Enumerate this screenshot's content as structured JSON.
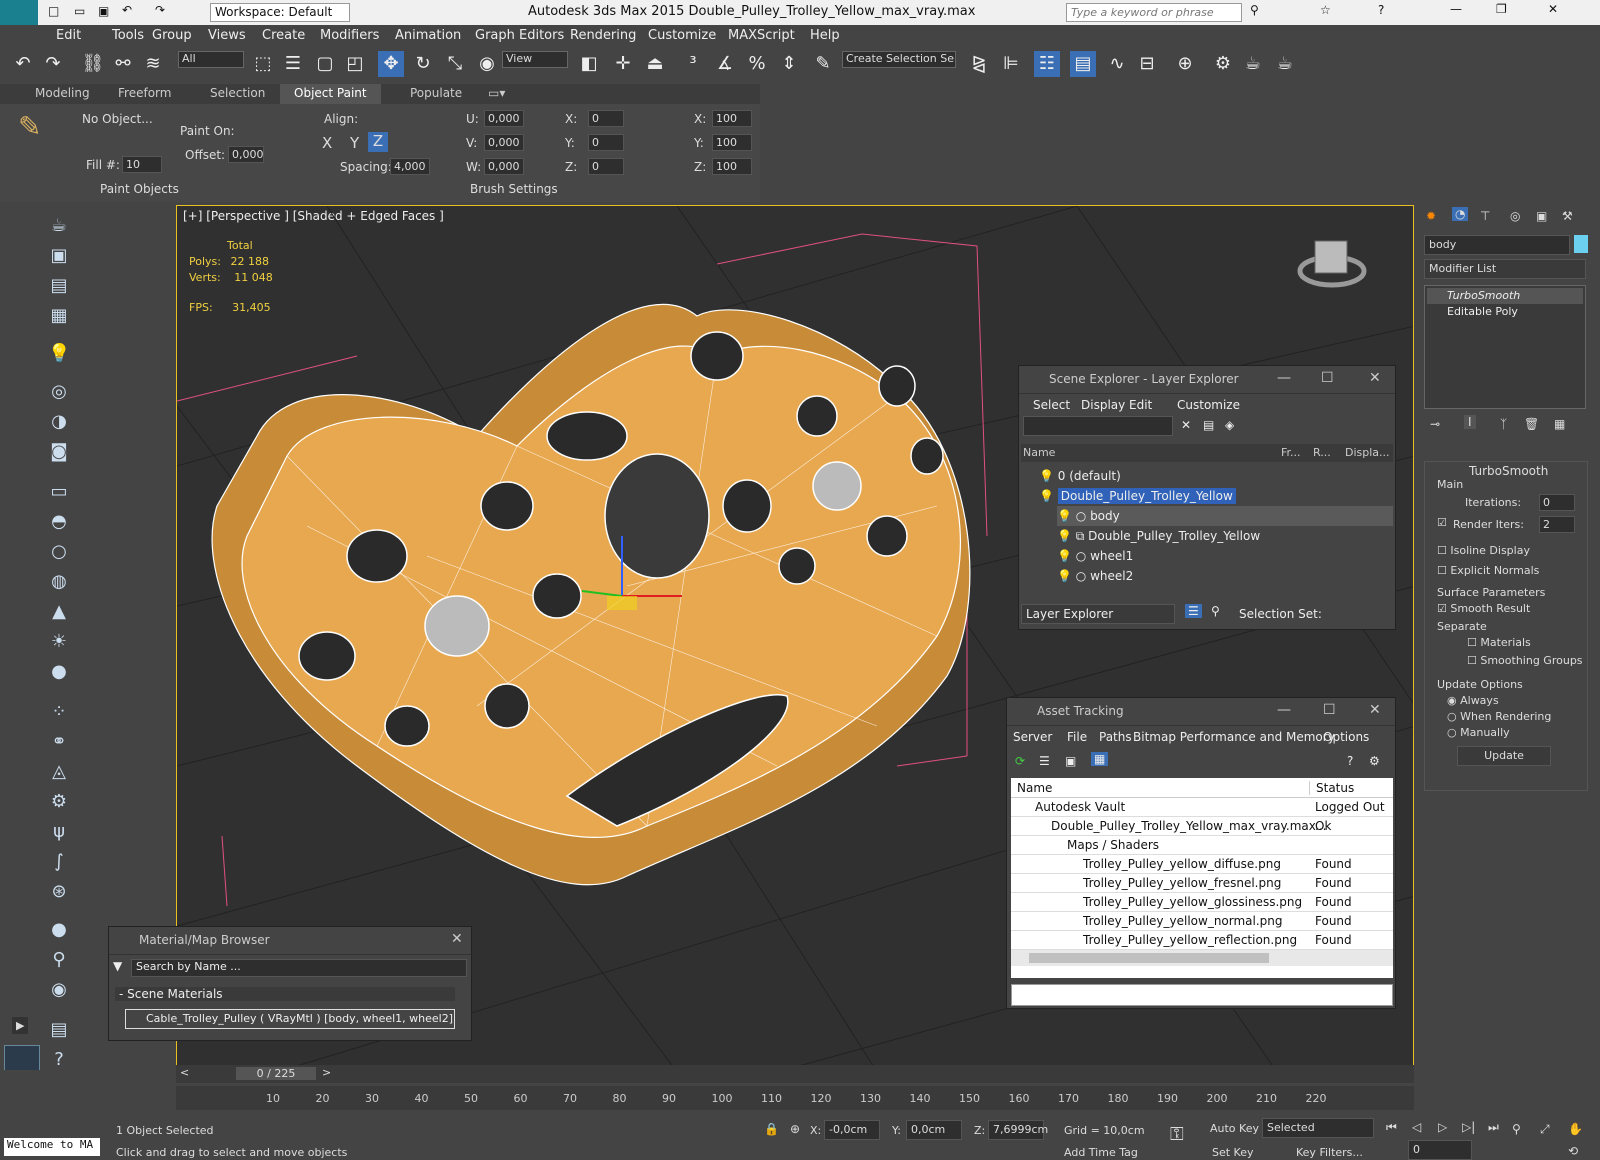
{
  "title": {
    "workspace": "Workspace: Default",
    "app_title": "Autodesk 3ds Max  2015     Double_Pulley_Trolley_Yellow_max_vray.max",
    "search_placeholder": "Type a keyword or phrase",
    "logo": "MAX"
  },
  "menu": [
    "Edit",
    "Tools",
    "Group",
    "Views",
    "Create",
    "Modifiers",
    "Animation",
    "Graph Editors",
    "Rendering",
    "Customize",
    "MAXScript",
    "Help"
  ],
  "toolbar": {
    "selection_filter": "All",
    "view_dropdown": "View",
    "selection_set": "Create Selection Se"
  },
  "ribbon": {
    "tabs": [
      "Modeling",
      "Freeform",
      "Selection",
      "Object Paint",
      "Populate"
    ],
    "active_tab": "Object Paint",
    "no_object": "No Object...",
    "paint_on": "Paint On:",
    "offset": "Offset:",
    "offset_val": "0,000",
    "fill": "Fill #:",
    "fill_val": "10",
    "align": "Align:",
    "x": "X",
    "y": "Y",
    "z": "Z",
    "spacing": "Spacing:",
    "spacing_val": "4,000",
    "u": "U:",
    "v": "V:",
    "w": "W:",
    "uval": "0,000",
    "vval": "0,000",
    "wval": "0,000",
    "rx": "X:",
    "ry": "Y:",
    "rz": "Z:",
    "rxv": "0",
    "ryv": "0",
    "rzv": "0",
    "sx": "X:",
    "sy": "Y:",
    "sz": "Z:",
    "sxv": "100",
    "syv": "100",
    "szv": "100",
    "paint_objects": "Paint Objects",
    "brush_settings": "Brush Settings"
  },
  "viewport": {
    "label": "[+] [Perspective ] [Shaded + Edged Faces ]",
    "total": "Total",
    "polys_label": "Polys:",
    "polys": "22 188",
    "verts_label": "Verts:",
    "verts": "11 048",
    "fps_label": "FPS:",
    "fps": "31,405"
  },
  "scene_explorer": {
    "title": "Scene Explorer - Layer Explorer",
    "menu": [
      "Select",
      "Display",
      "Edit",
      "Customize"
    ],
    "cols": [
      "Name",
      "Fr...",
      "R...",
      "Displa..."
    ],
    "rows": [
      "0 (default)",
      "Double_Pulley_Trolley_Yellow",
      "body",
      "Double_Pulley_Trolley_Yellow",
      "wheel1",
      "wheel2"
    ],
    "footer": "Layer Explorer",
    "selection_set": "Selection Set:"
  },
  "asset_tracking": {
    "title": "Asset Tracking",
    "menu": [
      "Server",
      "File",
      "Paths",
      "Bitmap Performance and Memory",
      "Options"
    ],
    "cols": [
      "Name",
      "Status"
    ],
    "rows": [
      {
        "name": "Autodesk Vault",
        "status": "Logged Out ..."
      },
      {
        "name": "Double_Pulley_Trolley_Yellow_max_vray.max",
        "status": "Ok"
      },
      {
        "name": "Maps / Shaders",
        "status": ""
      },
      {
        "name": "Trolley_Pulley_yellow_diffuse.png",
        "status": "Found"
      },
      {
        "name": "Trolley_Pulley_yellow_fresnel.png",
        "status": "Found"
      },
      {
        "name": "Trolley_Pulley_yellow_glossiness.png",
        "status": "Found"
      },
      {
        "name": "Trolley_Pulley_yellow_normal.png",
        "status": "Found"
      },
      {
        "name": "Trolley_Pulley_yellow_reflection.png",
        "status": "Found"
      }
    ]
  },
  "material_browser": {
    "title": "Material/Map Browser",
    "search": "Search by Name ...",
    "section": "- Scene Materials",
    "item": "Cable_Trolley_Pulley  ( VRayMtl )  [body, wheel1, wheel2]"
  },
  "command_panel": {
    "object_name": "body",
    "modifier_list": "Modifier List",
    "stack": [
      "TurboSmooth",
      "Editable Poly"
    ],
    "rollout": "TurboSmooth",
    "main": "Main",
    "iterations": "Iterations:",
    "iter_val": "0",
    "render_iters": "Render Iters:",
    "render_val": "2",
    "isoline": "Isoline Display",
    "explicit": "Explicit Normals",
    "surface": "Surface Parameters",
    "smooth": "Smooth Result",
    "separate": "Separate",
    "materials": "Materials",
    "smoothing": "Smoothing Groups",
    "update_opts": "Update Options",
    "always": "Always",
    "when_rendering": "When Rendering",
    "manually": "Manually",
    "update": "Update"
  },
  "timeline": {
    "frame": "0 / 225",
    "ticks": [
      "10",
      "20",
      "30",
      "40",
      "50",
      "60",
      "70",
      "80",
      "90",
      "100",
      "110",
      "120",
      "130",
      "140",
      "150",
      "160",
      "170",
      "180",
      "190",
      "200",
      "210",
      "220"
    ]
  },
  "status": {
    "welcome": "Welcome to MA",
    "selected": "1 Object Selected",
    "prompt": "Click and drag to select and move objects",
    "x": "X:",
    "xv": "-0,0cm",
    "y": "Y:",
    "yv": "0,0cm",
    "z": "Z:",
    "zv": "7,6999cm",
    "grid": "Grid = 10,0cm",
    "add_time_tag": "Add Time Tag",
    "auto_key": "Auto Key",
    "set_key": "Set Key",
    "selected_dd": "Selected",
    "key_filters": "Key Filters...",
    "frame_field": "0"
  }
}
